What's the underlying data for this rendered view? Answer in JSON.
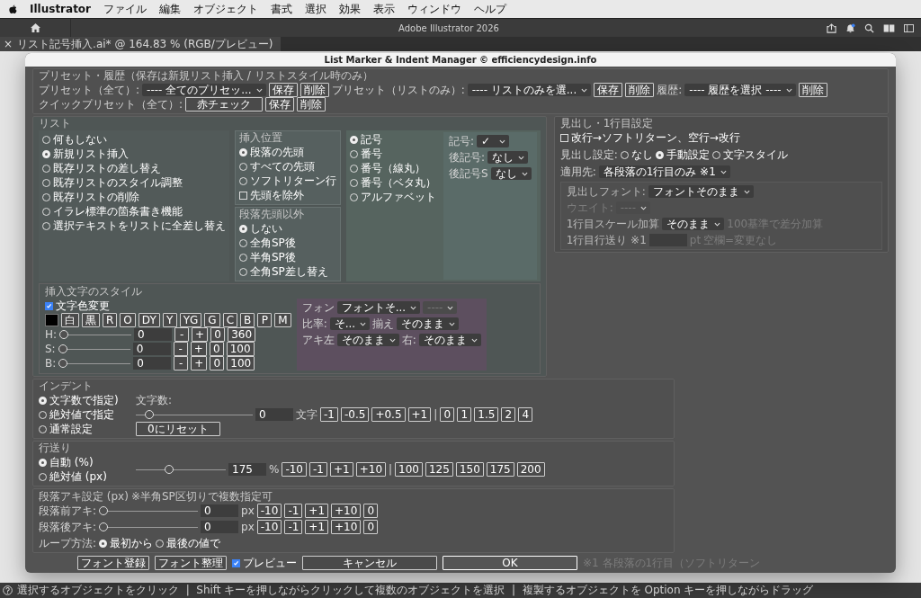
{
  "menubar": {
    "app": "Illustrator",
    "items": [
      "ファイル",
      "編集",
      "オブジェクト",
      "書式",
      "選択",
      "効果",
      "表示",
      "ウィンドウ",
      "ヘルプ"
    ]
  },
  "app_title": "Adobe Illustrator 2026",
  "doc_tab": {
    "close": "×",
    "title": "リスト記号挿入.ai* @ 164.83 % (RGB/プレビュー)"
  },
  "dialog": {
    "title": "List Marker & Indent Manager © efficiencydesign.info",
    "preset": {
      "heading": "プリセット・履歴（保存は新規リスト挿入 / リストスタイル時のみ）",
      "rows": [
        [
          {
            "kind": "label",
            "text": "プリセット（全て）:"
          },
          {
            "kind": "select",
            "value": "---- 全てのプリセッ..."
          },
          {
            "kind": "button",
            "label": "保存"
          },
          {
            "kind": "button",
            "label": "削除"
          },
          {
            "kind": "label",
            "text": "プリセット（リストのみ）:"
          },
          {
            "kind": "select",
            "value": "---- リストのみを選..."
          },
          {
            "kind": "button",
            "label": "保存"
          },
          {
            "kind": "button",
            "label": "削除"
          },
          {
            "kind": "label",
            "text": "履歴:"
          },
          {
            "kind": "select",
            "value": "---- 履歴を選択 ----"
          },
          {
            "kind": "button",
            "label": "削除"
          }
        ],
        [
          {
            "kind": "label",
            "text": "クイックプリセット（全て）:"
          },
          {
            "kind": "wide",
            "label": "赤チェック"
          },
          {
            "kind": "button",
            "label": "保存"
          },
          {
            "kind": "button",
            "label": "削除"
          }
        ]
      ]
    },
    "list": {
      "heading": "リスト",
      "modes": [
        {
          "kind": "radio",
          "label": "何もしない",
          "selected": false
        },
        {
          "kind": "radio",
          "label": "新規リスト挿入",
          "selected": true
        },
        {
          "kind": "radio",
          "label": "既存リストの差し替え",
          "selected": false
        },
        {
          "kind": "radio",
          "label": "既存リストのスタイル調整",
          "selected": false
        },
        {
          "kind": "radio",
          "label": "既存リストの削除",
          "selected": false
        },
        {
          "kind": "radio",
          "label": "イラレ標準の箇条書き機能",
          "selected": false
        },
        {
          "kind": "radio",
          "label": "選択テキストをリストに全差し替え",
          "selected": false
        }
      ],
      "insert_position": {
        "heading": "挿入位置",
        "options": [
          {
            "kind": "radio",
            "label": "段落の先頭",
            "selected": true
          },
          {
            "kind": "radio",
            "label": "すべての先頭",
            "selected": false
          },
          {
            "kind": "radio",
            "label": "ソフトリターン行",
            "selected": false
          },
          {
            "kind": "checkbox",
            "label": "先頭を除外",
            "checked": false
          }
        ]
      },
      "non_head": {
        "heading": "段落先頭以外",
        "options": [
          {
            "kind": "radio",
            "label": "しない",
            "selected": true
          },
          {
            "kind": "radio",
            "label": "全角SP後",
            "selected": false
          },
          {
            "kind": "radio",
            "label": "半角SP後",
            "selected": false
          },
          {
            "kind": "radio",
            "label": "全角SP差し替え",
            "selected": false
          }
        ]
      },
      "marker_types": [
        {
          "kind": "radio",
          "label": "記号",
          "selected": true
        },
        {
          "kind": "radio",
          "label": "番号",
          "selected": false
        },
        {
          "kind": "radio",
          "label": "番号（線丸）",
          "selected": false
        },
        {
          "kind": "radio",
          "label": "番号（ベタ丸）",
          "selected": false
        },
        {
          "kind": "radio",
          "label": "アルファベット",
          "selected": false
        }
      ],
      "marker_fields": [
        [
          {
            "kind": "label",
            "text": "記号:"
          },
          {
            "kind": "select",
            "value": "✓"
          }
        ],
        [
          {
            "kind": "label",
            "text": "後記号:"
          },
          {
            "kind": "select",
            "value": "なし"
          }
        ],
        [
          {
            "kind": "label",
            "text": "後記号S"
          },
          {
            "kind": "select",
            "value": "なし"
          }
        ]
      ]
    },
    "style": {
      "heading": "挿入文字のスタイル",
      "left_rows": [
        [
          {
            "kind": "checkbox",
            "label": "文字色変更",
            "checked": true
          }
        ],
        [
          {
            "kind": "swatch"
          },
          {
            "kind": "button",
            "label": "白"
          },
          {
            "kind": "button",
            "label": "黒"
          },
          {
            "kind": "button",
            "label": "R"
          },
          {
            "kind": "button",
            "label": "O"
          },
          {
            "kind": "button",
            "label": "DY"
          },
          {
            "kind": "button",
            "label": "Y"
          },
          {
            "kind": "button",
            "label": "YG"
          },
          {
            "kind": "button",
            "label": "G"
          },
          {
            "kind": "button",
            "label": "C"
          },
          {
            "kind": "button",
            "label": "B"
          },
          {
            "kind": "button",
            "label": "P"
          },
          {
            "kind": "button",
            "label": "M"
          }
        ],
        [
          {
            "kind": "label",
            "text": "H:"
          },
          {
            "kind": "slider",
            "level": 0
          },
          {
            "kind": "input",
            "value": "0"
          },
          {
            "kind": "button",
            "label": "-"
          },
          {
            "kind": "button",
            "label": "+"
          },
          {
            "kind": "button",
            "label": "0"
          },
          {
            "kind": "button",
            "label": "360"
          }
        ],
        [
          {
            "kind": "label",
            "text": "S:"
          },
          {
            "kind": "slider",
            "level": 0
          },
          {
            "kind": "input",
            "value": "0"
          },
          {
            "kind": "button",
            "label": "-"
          },
          {
            "kind": "button",
            "label": "+"
          },
          {
            "kind": "button",
            "label": "0"
          },
          {
            "kind": "button",
            "label": "100"
          }
        ],
        [
          {
            "kind": "label",
            "text": "B:"
          },
          {
            "kind": "slider",
            "level": 0
          },
          {
            "kind": "input",
            "value": "0"
          },
          {
            "kind": "button",
            "label": "-"
          },
          {
            "kind": "button",
            "label": "+"
          },
          {
            "kind": "button",
            "label": "0"
          },
          {
            "kind": "button",
            "label": "100"
          }
        ]
      ],
      "right_rows": [
        [
          {
            "kind": "label",
            "text": "フォン"
          },
          {
            "kind": "select",
            "value": "フォントそ..."
          },
          {
            "kind": "select",
            "value": "----",
            "disabled": true
          }
        ],
        [
          {
            "kind": "label",
            "text": "比率:"
          },
          {
            "kind": "select",
            "value": "そ..."
          },
          {
            "kind": "label",
            "text": "揃え"
          },
          {
            "kind": "select",
            "value": "そのまま"
          }
        ],
        [
          {
            "kind": "label",
            "text": "アキ左"
          },
          {
            "kind": "select",
            "value": "そのまま"
          },
          {
            "kind": "label",
            "text": "右:"
          },
          {
            "kind": "select",
            "value": "そのまま"
          }
        ]
      ]
    },
    "heading_settings": {
      "heading": "見出し・1行目設定",
      "rows": [
        [
          {
            "kind": "checkbox",
            "label": "改行→ソフトリターン、空行→改行",
            "checked": false
          }
        ],
        [
          {
            "kind": "label",
            "text": "見出し設定:"
          },
          {
            "kind": "radio",
            "label": "なし",
            "selected": false
          },
          {
            "kind": "radio",
            "label": "手動設定",
            "selected": true
          },
          {
            "kind": "radio",
            "label": "文字スタイル",
            "selected": false
          }
        ],
        [
          {
            "kind": "label",
            "text": "適用先:"
          },
          {
            "kind": "select",
            "value": "各段落の1行目のみ ※1"
          }
        ]
      ],
      "sub_rows": [
        [
          {
            "kind": "label",
            "text": "見出しフォント:"
          },
          {
            "kind": "select",
            "value": "フォントそのまま"
          }
        ],
        [
          {
            "kind": "note",
            "text": "ウエイト:"
          },
          {
            "kind": "select",
            "value": "----",
            "disabled": true
          }
        ],
        [
          {
            "kind": "label",
            "text": "1行目スケール加算"
          },
          {
            "kind": "select",
            "value": "そのまま"
          },
          {
            "kind": "note",
            "text": "100基準で差分加算"
          }
        ],
        [
          {
            "kind": "label",
            "text": "1行目行送り ※1"
          },
          {
            "kind": "input"
          },
          {
            "kind": "note",
            "text": "pt"
          },
          {
            "kind": "note",
            "text": "空欄=変更なし"
          }
        ]
      ]
    },
    "indent": {
      "heading": "インデント",
      "options": [
        {
          "kind": "radio",
          "label": "文字数で指定)",
          "selected": true
        },
        {
          "kind": "radio",
          "label": "絶対値で指定",
          "selected": false
        },
        {
          "kind": "radio",
          "label": "通常設定",
          "selected": false
        }
      ],
      "reset": {
        "kind": "wide",
        "label": "0にリセット"
      },
      "caption": {
        "kind": "label",
        "text": "文字数:"
      },
      "row": [
        {
          "kind": "slider",
          "level": 0.08
        },
        {
          "kind": "input",
          "value": "0"
        },
        {
          "kind": "label",
          "text": "文字"
        },
        {
          "kind": "button",
          "label": "-1"
        },
        {
          "kind": "button",
          "label": "-0.5"
        },
        {
          "kind": "button",
          "label": "+0.5"
        },
        {
          "kind": "button",
          "label": "+1"
        },
        {
          "kind": "label",
          "text": "|"
        },
        {
          "kind": "button",
          "label": "0"
        },
        {
          "kind": "button",
          "label": "1"
        },
        {
          "kind": "button",
          "label": "1.5"
        },
        {
          "kind": "button",
          "label": "2"
        },
        {
          "kind": "button",
          "label": "4"
        }
      ]
    },
    "line_spacing": {
      "heading": "行送り",
      "options": [
        {
          "kind": "radio",
          "label": "自動 (%)",
          "selected": true
        },
        {
          "kind": "radio",
          "label": "絶対値 (px)",
          "selected": false
        }
      ],
      "row": [
        {
          "kind": "slider",
          "level": 0.35
        },
        {
          "kind": "input",
          "value": "175"
        },
        {
          "kind": "label",
          "text": "%"
        },
        {
          "kind": "button",
          "label": "-10"
        },
        {
          "kind": "button",
          "label": "-1"
        },
        {
          "kind": "button",
          "label": "+1"
        },
        {
          "kind": "button",
          "label": "+10"
        },
        {
          "kind": "label",
          "text": "|"
        },
        {
          "kind": "button",
          "label": "100"
        },
        {
          "kind": "button",
          "label": "125"
        },
        {
          "kind": "button",
          "label": "150"
        },
        {
          "kind": "button",
          "label": "175"
        },
        {
          "kind": "button",
          "label": "200"
        }
      ]
    },
    "paragraph_spacing": {
      "heading": "段落アキ設定 (px)",
      "note": "※半角SP区切りで複数指定可",
      "rows": [
        [
          {
            "kind": "label",
            "text": "段落前アキ:"
          },
          {
            "kind": "slider",
            "level": 0
          },
          {
            "kind": "input",
            "value": "0"
          },
          {
            "kind": "label",
            "text": "px"
          },
          {
            "kind": "button",
            "label": "-10"
          },
          {
            "kind": "button",
            "label": "-1"
          },
          {
            "kind": "button",
            "label": "+1"
          },
          {
            "kind": "button",
            "label": "+10"
          },
          {
            "kind": "button",
            "label": "0"
          }
        ],
        [
          {
            "kind": "label",
            "text": "段落後アキ:"
          },
          {
            "kind": "slider",
            "level": 0
          },
          {
            "kind": "input",
            "value": "0"
          },
          {
            "kind": "label",
            "text": "px"
          },
          {
            "kind": "button",
            "label": "-10"
          },
          {
            "kind": "button",
            "label": "-1"
          },
          {
            "kind": "button",
            "label": "+1"
          },
          {
            "kind": "button",
            "label": "+10"
          },
          {
            "kind": "button",
            "label": "0"
          }
        ],
        [
          {
            "kind": "label",
            "text": "ループ方法:"
          },
          {
            "kind": "radio",
            "label": "最初から",
            "selected": true
          },
          {
            "kind": "radio",
            "label": "最後の値で",
            "selected": false
          }
        ]
      ]
    },
    "footer": [
      {
        "kind": "button",
        "label": "フォント登録"
      },
      {
        "kind": "button",
        "label": "フォント整理"
      },
      {
        "kind": "checkbox",
        "label": "プレビュー",
        "checked": true
      },
      {
        "kind": "wide",
        "label": "キャンセル"
      },
      {
        "kind": "primary",
        "label": "OK"
      },
      {
        "kind": "note",
        "text": "※1 各段落の1行目（ソフトリターン"
      }
    ]
  },
  "status_bar": "選択するオブジェクトをクリック  |  Shift キーを押しながらクリックして複数のオブジェクトを選択  |  複製するオブジェクトを Option キーを押しながらドラッグ"
}
